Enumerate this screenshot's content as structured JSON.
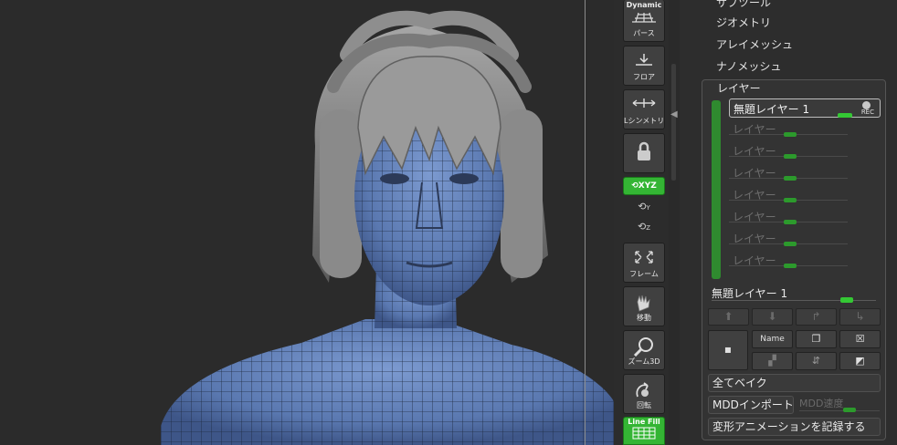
{
  "shelf": {
    "perspective": {
      "top": "Dynamic",
      "label": "パース"
    },
    "floor": {
      "label": "フロア"
    },
    "symmetry": {
      "label": "Lシンメトリ"
    },
    "lock": {
      "label": ""
    },
    "xyz": {
      "label": "XYZ"
    },
    "rotate_y": {
      "label": "Y"
    },
    "rotate_z": {
      "label": "Z"
    },
    "frame": {
      "label": "フレーム"
    },
    "move": {
      "label": "移動"
    },
    "zoom3d": {
      "label": "ズーム3D"
    },
    "rotate": {
      "label": "回転"
    },
    "linefill": {
      "label": "Line Fill"
    }
  },
  "palette": {
    "menu": [
      "サブツール",
      "ジオメトリ",
      "アレイメッシュ",
      "ナノメッシュ"
    ],
    "layers": {
      "title": "レイヤー",
      "active_layer": "無題レイヤー 1",
      "rec": "REC",
      "rows": [
        "レイヤー",
        "レイヤー",
        "レイヤー",
        "レイヤー",
        "レイヤー",
        "レイヤー",
        "レイヤー"
      ],
      "selected_name": "無題レイヤー 1",
      "name_button": "Name",
      "bake_all": "全てベイク",
      "mdd_import": "MDDインポート",
      "mdd_speed": "MDD速度",
      "record_anim": "変形アニメーションを記録する"
    }
  },
  "colors": {
    "accent_green": "#34b534",
    "mesh_blue": "#5a7cb8",
    "hair_gray": "#8c8c8c"
  }
}
